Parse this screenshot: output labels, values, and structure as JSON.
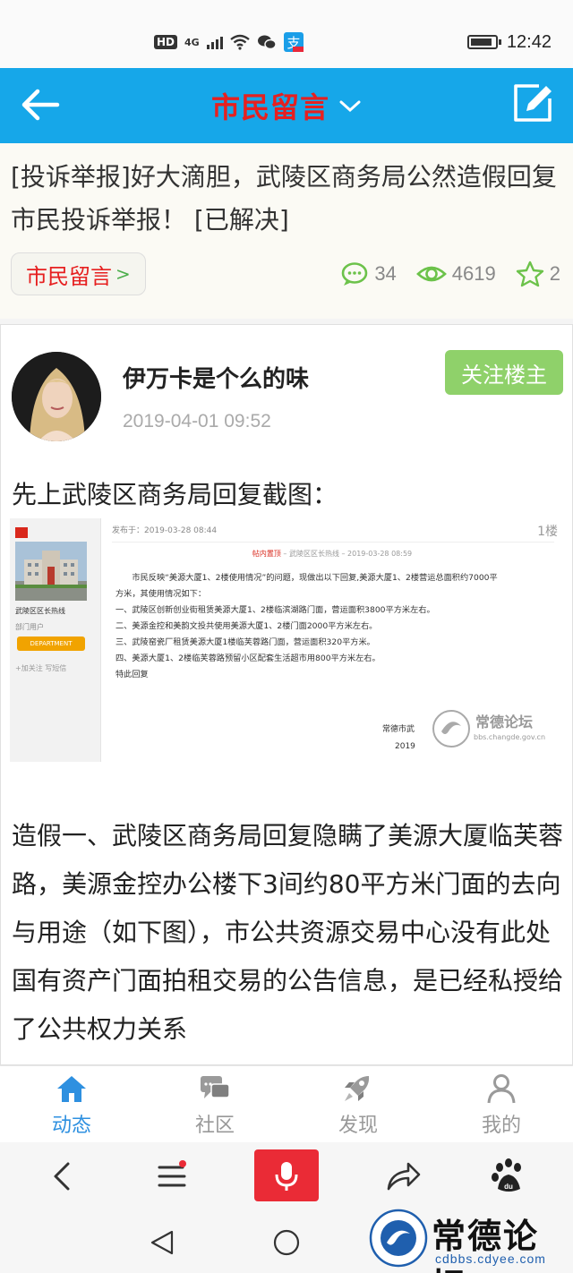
{
  "status_bar": {
    "hd": "HD",
    "network": "4G",
    "time": "12:42",
    "battery_level": 0.9,
    "icons": [
      "signal-icon",
      "wifi-icon",
      "wechat-icon",
      "alipay-icon",
      "battery-icon"
    ]
  },
  "header": {
    "title": "市民留言",
    "title_color": "#e62020",
    "bar_color": "#16a7e9"
  },
  "topic": {
    "title": "[投诉举报]好大滴胆，武陵区商务局公然造假回复市民投诉举报！ [已解决]",
    "tag": "市民留言",
    "tag_arrow": ">",
    "replies": "34",
    "views": "4619",
    "favorites": "2"
  },
  "post": {
    "author": "伊万卡是个么的味",
    "time": "2019-04-01 09:52",
    "follow_label": "关注楼主",
    "intro": "先上武陵区商务局回复截图：",
    "screenshot": {
      "side_title": "武陵区区长热线",
      "side_role": "部门用户",
      "side_badge": "DEPARTMENT",
      "side_actions": "+加关注   写短信",
      "post_time": "发布于：2019-03-28 08:44",
      "floor": "1楼",
      "sub_red": "帖内置顶",
      "sub_rest": " – 武陵区区长热线 – 2019-03-28 08:59",
      "lines": [
        "市民反映“美源大厦1、2楼使用情况”的问题，现做出以下回复,美源大厦1、2楼营运总面积约7000平",
        "方米，其使用情况如下：",
        "一、武陵区创新创业街租赁美源大厦1、2楼临滨湖路门面，营运面积3800平方米左右。",
        "二、美源金控和美韵文投共使用美源大厦1、2楼门面2000平方米左右。",
        "三、武陵窑瓷厂租赁美源大厦1楼临芙蓉路门面，营运面积320平方米。",
        "四、美源大厦1、2楼临芙蓉路预留小区配套生活超市用800平方米左右。",
        "特此回复"
      ],
      "sign_1": "常德市武",
      "sign_2": "2019",
      "watermark_title": "常德论坛",
      "watermark_url": "bbs.changde.gov.cn"
    },
    "body": "造假一、武陵区商务局回复隐瞒了美源大厦临芙蓉路，美源金控办公楼下3间约80平方米门面的去向与用途（如下图），市公共资源交易中心没有此处国有资产门面拍租交易的公告信息，是已经私授给了公共权力关系"
  },
  "tabbar": {
    "tabs": [
      {
        "label": "动态",
        "icon": "home-icon",
        "active": true
      },
      {
        "label": "社区",
        "icon": "chat-icon",
        "active": false
      },
      {
        "label": "发现",
        "icon": "rocket-icon",
        "active": false
      },
      {
        "label": "我的",
        "icon": "user-icon",
        "active": false
      }
    ],
    "active_color": "#2e90e0"
  },
  "browser_bar": {
    "icons": [
      "back-icon",
      "menu-icon",
      "microphone-icon",
      "share-icon",
      "baidu-paw-icon"
    ],
    "voice_color": "#ea2b36"
  },
  "brand_watermark": {
    "title": "常德论坛",
    "url": "cdbbs.cdyee.com"
  }
}
